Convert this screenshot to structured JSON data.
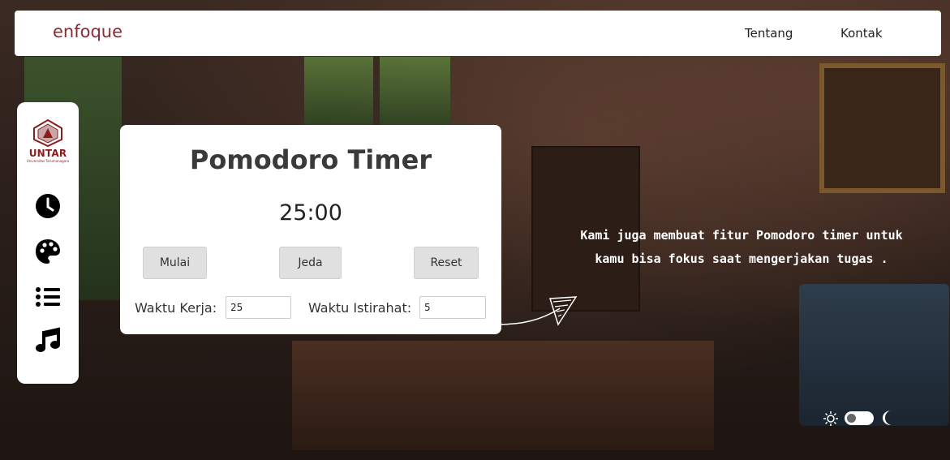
{
  "brand": "enfoque",
  "nav": {
    "tentang": "Tentang",
    "kontak": "Kontak"
  },
  "sidebar": {
    "logo_text": "UNTAR",
    "logo_subtext": "Universitas Tarumanagara",
    "icons": [
      "clock-icon",
      "palette-icon",
      "list-icon",
      "music-icon"
    ]
  },
  "timer": {
    "title": "Pomodoro Timer",
    "time": "25:00",
    "buttons": {
      "start": "Mulai",
      "pause": "Jeda",
      "reset": "Reset"
    },
    "work_label": "Waktu Kerja:",
    "work_value": "25",
    "break_label": "Waktu Istirahat:",
    "break_value": "5"
  },
  "note": {
    "line1": "Kami juga membuat fitur Pomodoro timer untuk",
    "line2": "kamu bisa fokus saat mengerjakan tugas ."
  },
  "theme": {
    "light_icon": "sun-icon",
    "dark_icon": "moon-icon",
    "mode": "light"
  },
  "colors": {
    "brand": "#8a2a33",
    "card": "#ffffff",
    "button": "#e0e0e0"
  }
}
